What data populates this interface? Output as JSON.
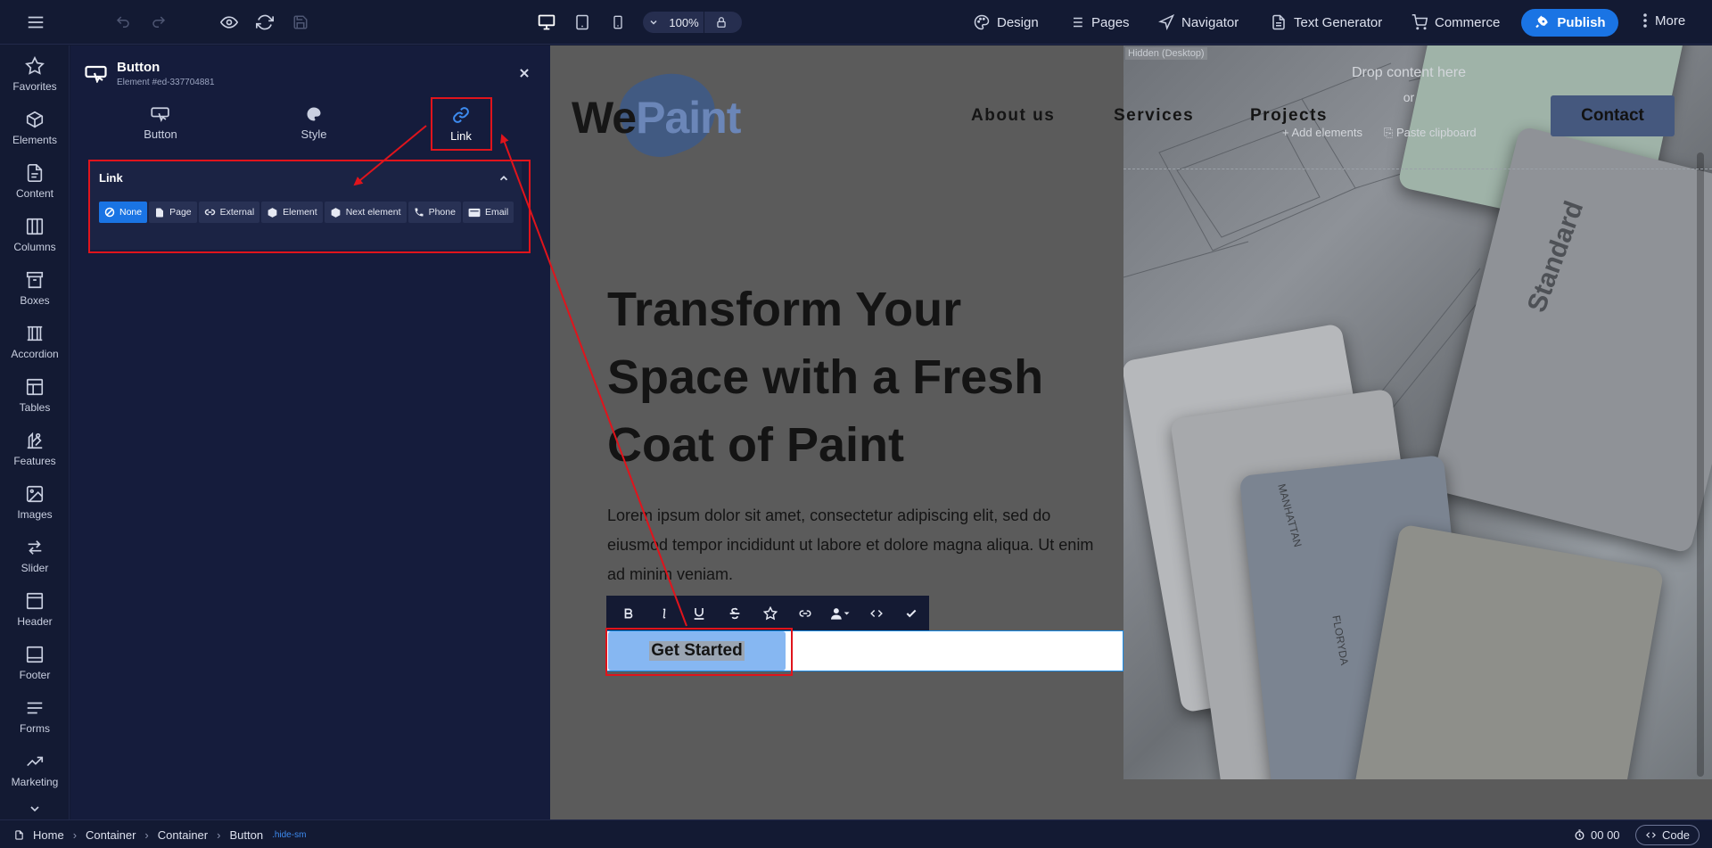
{
  "toolbar": {
    "zoom": "100%",
    "menu": [
      {
        "label": "Design",
        "icon": "palette-icon"
      },
      {
        "label": "Pages",
        "icon": "list-icon"
      },
      {
        "label": "Navigator",
        "icon": "navigation-icon"
      },
      {
        "label": "Text Generator",
        "icon": "document-icon"
      },
      {
        "label": "Commerce",
        "icon": "cart-icon"
      }
    ],
    "publish_label": "Publish",
    "more_label": "More"
  },
  "sidebar": {
    "items": [
      {
        "label": "Favorites",
        "icon": "star-icon"
      },
      {
        "label": "Elements",
        "icon": "cube-icon"
      },
      {
        "label": "Content",
        "icon": "content-icon"
      },
      {
        "label": "Columns",
        "icon": "columns-icon"
      },
      {
        "label": "Boxes",
        "icon": "box-icon"
      },
      {
        "label": "Accordion",
        "icon": "accordion-icon"
      },
      {
        "label": "Tables",
        "icon": "table-icon"
      },
      {
        "label": "Features",
        "icon": "features-icon"
      },
      {
        "label": "Images",
        "icon": "image-icon"
      },
      {
        "label": "Slider",
        "icon": "slider-icon"
      },
      {
        "label": "Header",
        "icon": "header-icon"
      },
      {
        "label": "Footer",
        "icon": "footer-icon"
      },
      {
        "label": "Forms",
        "icon": "forms-icon"
      },
      {
        "label": "Marketing",
        "icon": "chart-up-icon"
      }
    ]
  },
  "panel": {
    "title": "Button",
    "subtitle": "Element #ed-337704881",
    "tabs": [
      {
        "label": "Button",
        "icon": "button-icon"
      },
      {
        "label": "Style",
        "icon": "palette-icon"
      },
      {
        "label": "Link",
        "icon": "link-icon"
      }
    ],
    "link_section": {
      "title": "Link",
      "types": [
        {
          "label": "None",
          "icon": "ban-icon"
        },
        {
          "label": "Page",
          "icon": "page-icon"
        },
        {
          "label": "External",
          "icon": "link-icon"
        },
        {
          "label": "Element",
          "icon": "cube-icon"
        },
        {
          "label": "Next element",
          "icon": "cube-icon"
        },
        {
          "label": "Phone",
          "icon": "phone-icon"
        },
        {
          "label": "Email",
          "icon": "email-icon"
        }
      ],
      "selected": "None"
    }
  },
  "preview": {
    "logo_we": "We",
    "logo_paint": "Paint",
    "nav": [
      "About us",
      "Services",
      "Projects"
    ],
    "contact": "Contact",
    "hidden_badge": "Hidden (Desktop)",
    "drop_text": "Drop content here",
    "drop_or": "or",
    "add_elements": "Add elements",
    "paste_clipboard": "Paste clipboard",
    "hero_title": "Transform Your Space with a Fresh Coat of Paint",
    "hero_text": "Lorem ipsum dolor sit amet, consectetur adipiscing elit, sed do eiusmod tempor incididunt ut labore et dolore magna aliqua. Ut enim ad minim veniam.",
    "button_label": "Get Started",
    "card_labels": [
      "Standard",
      "MANHATTAN",
      "FLORYDA"
    ]
  },
  "statusbar": {
    "crumbs": [
      "Home",
      "Container",
      "Container",
      "Button"
    ],
    "tag": ".hide-sm",
    "timer": "00 00",
    "code_label": "Code"
  },
  "colors": {
    "accent": "#1a74e4",
    "highlight": "#e0141c",
    "panel_bg": "#151c3c",
    "canvas_bg": "#5b5b5b"
  }
}
